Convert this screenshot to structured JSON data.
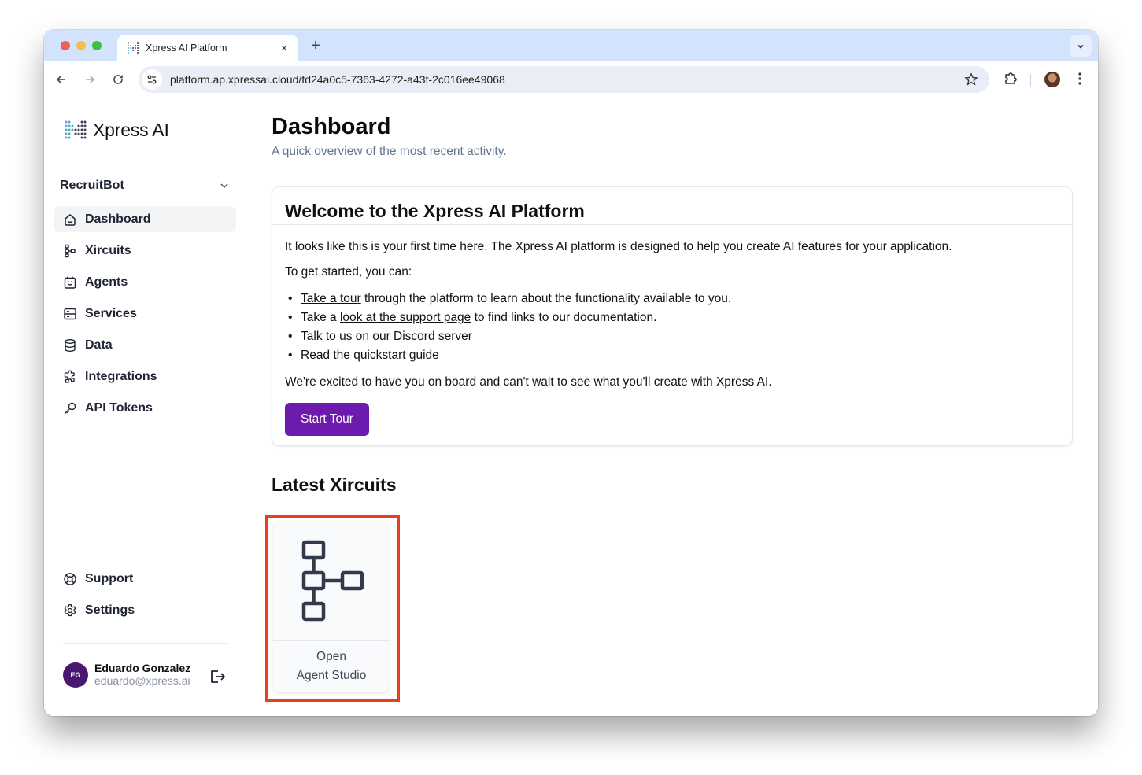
{
  "browser": {
    "tab_title": "Xpress AI Platform",
    "url": "platform.ap.xpressai.cloud/fd24a0c5-7363-4272-a43f-2c016ee49068",
    "close_tab_glyph": "×",
    "new_tab_glyph": "+"
  },
  "sidebar": {
    "brand": "Xpress AI",
    "project": "RecruitBot",
    "items": [
      {
        "label": "Dashboard",
        "icon": "home-icon",
        "active": true
      },
      {
        "label": "Xircuits",
        "icon": "workflow-icon"
      },
      {
        "label": "Agents",
        "icon": "robot-icon"
      },
      {
        "label": "Services",
        "icon": "server-icon"
      },
      {
        "label": "Data",
        "icon": "database-icon"
      },
      {
        "label": "Integrations",
        "icon": "puzzle-icon"
      },
      {
        "label": "API Tokens",
        "icon": "key-icon"
      }
    ],
    "bottom_items": [
      {
        "label": "Support",
        "icon": "lifebuoy-icon"
      },
      {
        "label": "Settings",
        "icon": "gear-icon"
      }
    ],
    "user": {
      "initials": "EG",
      "name": "Eduardo Gonzalez",
      "email": "eduardo@xpress.ai"
    }
  },
  "main": {
    "title": "Dashboard",
    "subtitle": "A quick overview of the most recent activity.",
    "welcome": {
      "title": "Welcome to the Xpress AI Platform",
      "intro": "It looks like this is your first time here. The Xpress AI platform is designed to help you create AI features for your application.",
      "get_started": "To get started, you can:",
      "bullets": [
        {
          "link": "Take a tour",
          "after": " through the platform to learn about the functionality available to you."
        },
        {
          "before": "Take a ",
          "link": "look at the support page",
          "after": " to find links to our documentation."
        },
        {
          "link": "Talk to us on our Discord server"
        },
        {
          "link": "Read the quickstart guide"
        }
      ],
      "outro": "We're excited to have you on board and can't wait to see what you'll create with Xpress AI.",
      "button": "Start Tour"
    },
    "latest_xircuits": {
      "title": "Latest Xircuits",
      "card": {
        "line1": "Open",
        "line2": "Agent Studio"
      }
    }
  },
  "colors": {
    "accent": "#6c1bae",
    "highlight": "#e8401c",
    "avatar": "#4a1770"
  }
}
